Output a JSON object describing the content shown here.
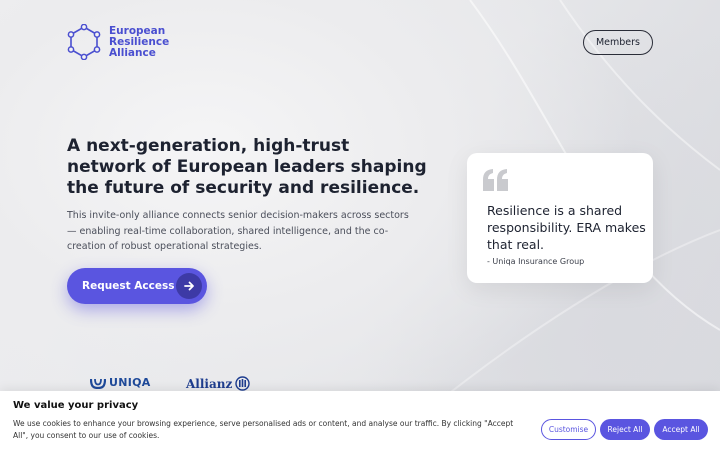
{
  "colors": {
    "brand": "#4a4fd0",
    "accent": "#5a55e0",
    "accent_dark": "#3d3aa6",
    "text": "#1d2230"
  },
  "header": {
    "logo_lines": [
      "European",
      "Resilience",
      "Alliance"
    ],
    "logo_icon": "hexagon-network-icon",
    "members_label": "Members"
  },
  "hero": {
    "title": "A next-generation, high-trust network of European leaders shaping the future of security and resilience.",
    "description": "This invite-only alliance connects senior decision-makers across sectors — enabling real-time collaboration, shared intelligence, and the co-creation of robust operational strategies.",
    "cta_label": "Request Access",
    "cta_icon": "arrow-right-icon"
  },
  "quote": {
    "icon": "quote-icon",
    "text": "Resilience is a shared responsibility. ERA makes that real.",
    "source": "- Uniqa Insurance Group"
  },
  "partners": [
    {
      "name": "UNIQA",
      "icon": "uniqa-logo-icon"
    },
    {
      "name": "Allianz",
      "icon": "allianz-logo-icon"
    }
  ],
  "cookie": {
    "title": "We value your privacy",
    "text": "We use cookies to enhance your browsing experience, serve personalised ads or content, and analyse our traffic. By clicking \"Accept All\", you consent to our use of cookies.",
    "customise_label": "Customise",
    "reject_label": "Reject All",
    "accept_label": "Accept All"
  }
}
